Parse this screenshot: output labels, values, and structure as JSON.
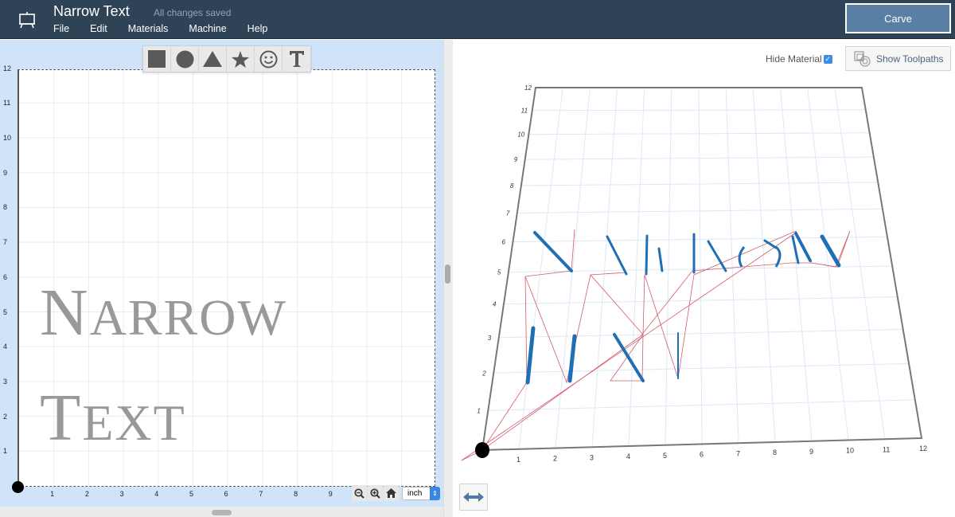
{
  "header": {
    "project_title": "Narrow Text",
    "save_status": "All changes saved",
    "menu": [
      "File",
      "Edit",
      "Materials",
      "Machine",
      "Help"
    ],
    "carve_label": "Carve"
  },
  "design": {
    "shape_tools": [
      {
        "name": "square",
        "icon": "square-icon"
      },
      {
        "name": "circle",
        "icon": "circle-icon"
      },
      {
        "name": "triangle",
        "icon": "triangle-icon"
      },
      {
        "name": "star",
        "icon": "star-icon"
      },
      {
        "name": "smiley",
        "icon": "smiley-icon"
      },
      {
        "name": "text",
        "icon": "text-icon"
      }
    ],
    "text_lines": [
      "Narrow",
      "Text"
    ],
    "y_ticks": [
      "12",
      "11",
      "10",
      "9",
      "8",
      "7",
      "6",
      "5",
      "4",
      "3",
      "2",
      "1"
    ],
    "x_ticks": [
      "1",
      "2",
      "3",
      "4",
      "5",
      "6",
      "7",
      "8",
      "9"
    ],
    "unit": "inch",
    "zoom_controls": [
      "zoom-out",
      "zoom-in",
      "home"
    ]
  },
  "preview": {
    "hide_material_label": "Hide Material",
    "hide_material_checked": true,
    "show_toolpaths_label": "Show Toolpaths",
    "y_ticks": [
      "1",
      "2",
      "3",
      "4",
      "5",
      "6",
      "7",
      "8",
      "9",
      "10",
      "11",
      "12"
    ],
    "x_ticks": [
      "1",
      "2",
      "3",
      "4",
      "5",
      "6",
      "7",
      "8",
      "9",
      "10",
      "11",
      "12"
    ],
    "colors": {
      "toolpath": "#1f6fb5",
      "travel": "#d45a6a",
      "grid": "#dbe9f8"
    }
  }
}
